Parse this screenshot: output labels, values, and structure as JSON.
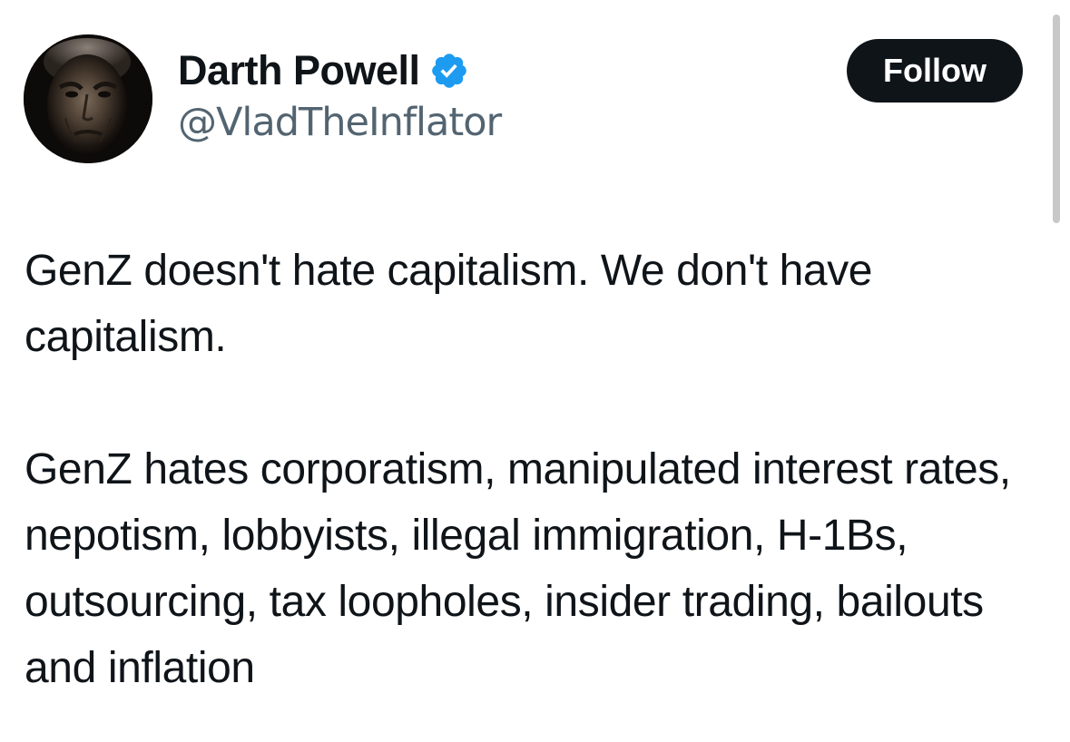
{
  "author": {
    "display_name": "Darth Powell",
    "handle": "@VladTheInflator",
    "verified": true,
    "avatar_icon": "profile-photo-dark-portrait"
  },
  "actions": {
    "follow_label": "Follow"
  },
  "tweet": {
    "paragraphs": [
      "GenZ doesn't hate capitalism.  We don't have capitalism.",
      "GenZ hates corporatism, manipulated interest rates, nepotism, lobbyists, illegal immigration, H-1Bs, outsourcing, tax loopholes, insider trading, bailouts and inflation"
    ]
  },
  "colors": {
    "text_primary": "#0f1419",
    "text_secondary": "#536471",
    "follow_button_bg": "#0f1419",
    "follow_button_text": "#ffffff",
    "verified_badge": "#1d9bf0",
    "background": "#ffffff"
  }
}
